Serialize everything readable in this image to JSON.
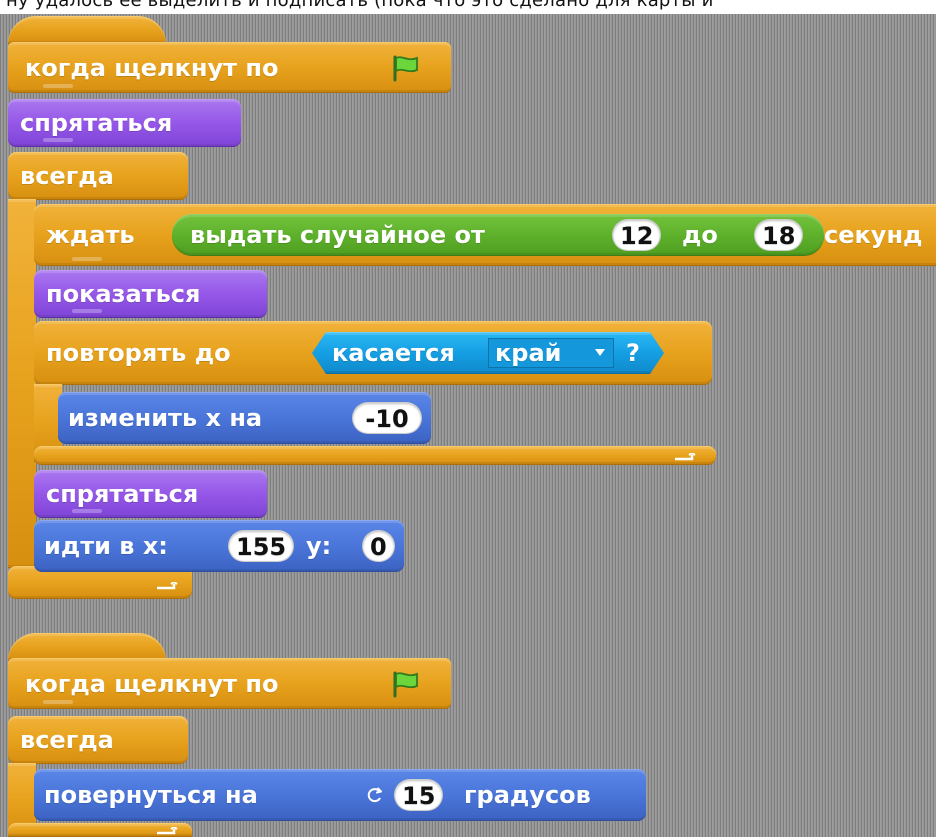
{
  "top_text": "ну удалось её выделить и подписать (пока что это сделано для карты и",
  "script1": {
    "hat_label": "когда щелкнут по",
    "hide_label": "спрятаться",
    "forever_label": "всегда",
    "wait_prefix": "ждать",
    "random_label": "выдать случайное от",
    "random_from": "12",
    "random_to_label": "до",
    "random_to": "18",
    "wait_suffix": "секунд",
    "show_label": "показаться",
    "repeat_until_label": "повторять до",
    "touching_label": "касается",
    "touching_dropdown": "край",
    "touching_qmark": "?",
    "change_x_label": "изменить х на",
    "change_x_value": "-10",
    "hide_label_2": "спрятаться",
    "goto_label": "идти в x:",
    "goto_x": "155",
    "goto_y_label": "y:",
    "goto_y": "0"
  },
  "script2": {
    "hat_label": "когда щелкнут по",
    "forever_label": "всегда",
    "turn_label": "повернуться на",
    "turn_value": "15",
    "turn_suffix": "градусов"
  },
  "icons": {
    "flag": "green-flag-icon",
    "rotate": "rotate-icon",
    "loop_arrow": "loop-arrow-icon"
  },
  "colors": {
    "control": "#e7a21d",
    "looks": "#9557e8",
    "motion": "#4a75d9",
    "operators": "#5eb12b",
    "sensing": "#159fe3"
  }
}
